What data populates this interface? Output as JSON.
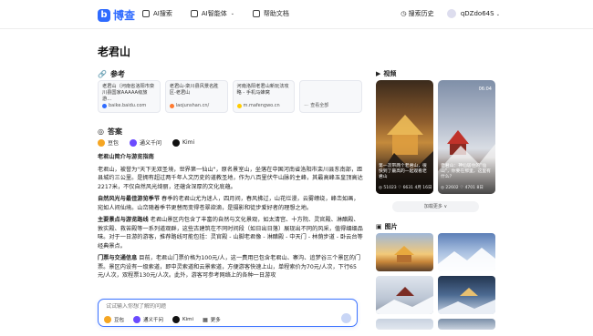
{
  "nav": {
    "logo_mark": "b",
    "logo_text": "博查",
    "items": [
      {
        "label": "AI搜索",
        "icon": "search-icon"
      },
      {
        "label": "AI智能体",
        "icon": "agent-icon"
      },
      {
        "label": "帮助文档",
        "icon": "doc-icon"
      }
    ],
    "history": "搜索历史",
    "user": "qDZdo64S"
  },
  "page_title": "老君山",
  "references": {
    "heading": "参考",
    "cards": [
      {
        "text": "老君山（河南省洛阳市栾川县国家AAAAA级旅游...",
        "source": "baike.baidu.com",
        "color": "#2f6bff"
      },
      {
        "text": "老君山-栾川县风景名胜区-老君山",
        "source": "laojunshan.cn/",
        "color": "#ff7a2f"
      },
      {
        "text": "河南洛阳老君山新玩法攻略 - 手机马蜂窝",
        "source": "m.mafengwo.cn",
        "color": "#ffcc00"
      },
      {
        "text": "",
        "source": "查看全部",
        "color": "#999999"
      }
    ]
  },
  "answer": {
    "heading": "答案",
    "models": [
      {
        "label": "豆包",
        "color": "#f5a623"
      },
      {
        "label": "通义千问",
        "color": "#6b4bff"
      },
      {
        "label": "Kimi",
        "color": "#111111"
      }
    ],
    "title": "老君山简介与游览指南",
    "p1": "老君山，被誉为\"天下无双圣境，世界第一仙山\"，原名景室山，坐落在中国河南省洛阳市栾川县东南部，距县城约三公里。是拥有超过两千年人文历史的道教圣地，作为八百里伏牛山脉的主峰，其最高峰玉皇顶高达2217米，不仅自然风光绮丽，还蕴含深厚的文化底蕴。",
    "p2_bold": "自然风光与最佳游览季节",
    "p2": " 春季的老君山尤为迷人，四月间，春风拂过，山花烂漫，云雾缭绕，峰峦如画，宛如人间仙境。山峦随着季节更替而变得苍翠欲滴，是摄影和徒步爱好者的理想之地。",
    "p3_bold": "主要景点与游览路线",
    "p3": " 老君山景区内包含了丰富的自然与文化景观，如太清宫、十方院、灵官殿、淋醋殿、敦实殿、救苦殿等一系列道观群，这些古建筑在不同时间段（如日出日落）展现出不同的风采，值得细细品味。对于一日游的游客，推荐路线可能包括：灵官殿 - 山脚老君像 - 淋醋殿 - 中天门 - 林荫步道 - 卧云台等经典景点。",
    "p4_bold": "门票与交通信息",
    "p4": " 目前，老君山门票价格为100元/人，这一费用已包含老君山、寨沟、追梦谷三个景区的门票。景区内设有一级索道，即中灵索道和云景索道，方便游客快速上山，单程索价为70元/人次，下行65元/人次，双程票130元/人次。此外，游客可参考网络上的各种一日游攻"
  },
  "input": {
    "placeholder": "试试输入你想了解的问题",
    "models": [
      {
        "label": "豆包",
        "color": "#f5a623"
      },
      {
        "label": "通义千问",
        "color": "#6b4bff"
      },
      {
        "label": "Kimi",
        "color": "#111111"
      },
      {
        "label": "更多",
        "color": "#555555"
      }
    ]
  },
  "videos": {
    "heading": "视频",
    "items": [
      {
        "duration": "",
        "title": "第一次带两个老君山，很快到了最高的一起观看老君山",
        "meta": "◎ 51023  ♡ 6631 4月 16日"
      },
      {
        "duration": "06:04",
        "title": "老君山：神仙居住的\"仙山\"，你要在那里，这里有什么？",
        "meta": "◎ 22602  ♡ 4701 8日"
      }
    ],
    "load_more": "加载更多 ∨"
  },
  "images": {
    "heading": "图片"
  },
  "colors": {
    "accent": "#2f6bff",
    "input_border": "#3b72ff"
  }
}
